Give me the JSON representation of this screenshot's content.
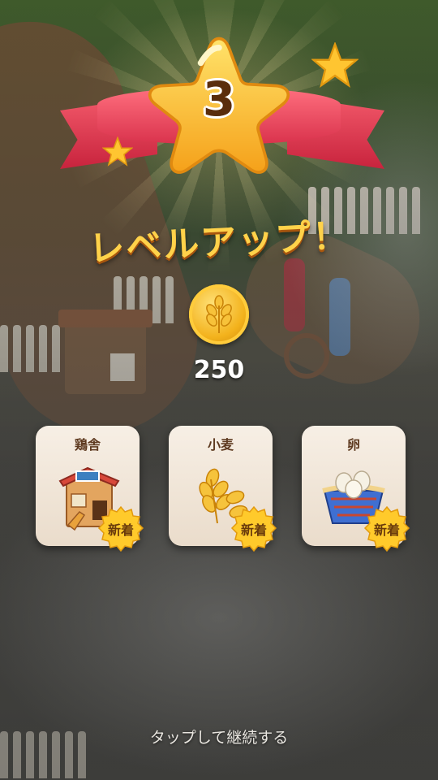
{
  "level": {
    "number": "3",
    "title": "レベルアップ！"
  },
  "reward": {
    "icon": "wheat-coin-icon",
    "amount": "250"
  },
  "unlocks": [
    {
      "label": "鶏舎",
      "icon": "chicken-coop-icon",
      "badge": "新着"
    },
    {
      "label": "小麦",
      "icon": "wheat-icon",
      "badge": "新着"
    },
    {
      "label": "卵",
      "icon": "egg-basket-icon",
      "badge": "新着"
    }
  ],
  "footer": {
    "continue_text": "タップして継続する"
  },
  "colors": {
    "title": "#ffd24a",
    "ribbon": "#e23a52",
    "star": "#ffc531",
    "coin": "#f3b21c",
    "card": "#f4ebdf"
  }
}
